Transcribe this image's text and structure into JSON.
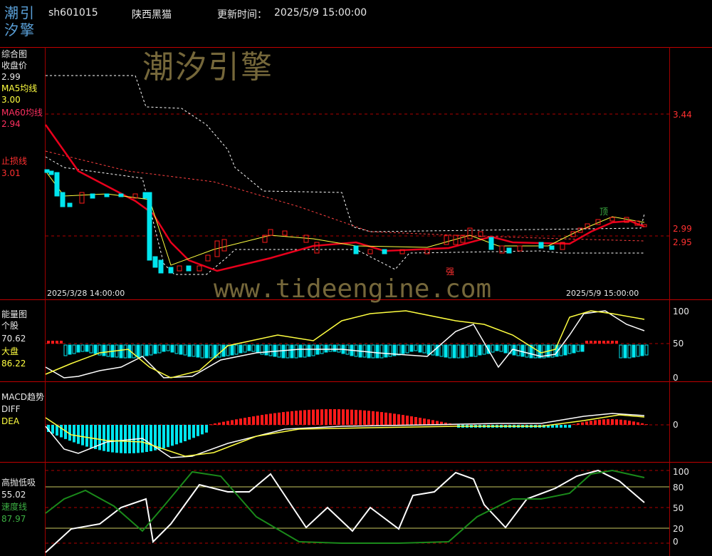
{
  "header": {
    "logo_line1": "潮引",
    "logo_line2": "汐擎",
    "code": "sh601015",
    "name": "陕西黑猫",
    "update_label": "更新时间：",
    "update_time": "2025/5/9 15:00:00"
  },
  "watermarks": {
    "brand": "潮汐引擎",
    "url": "www.tideengine.com"
  },
  "main_panel": {
    "title": "综合图",
    "close_label": "收盘价",
    "close_value": "2.99",
    "ma5_label": "MA5均线",
    "ma5_value": "3.00",
    "ma60_label": "MA60均线",
    "ma60_value": "2.94",
    "stop_label": "止损线",
    "stop_value": "3.01",
    "price_ticks": [
      "3.44",
      "2.99",
      "2.95"
    ],
    "top_marker": "顶",
    "strong_marker": "强",
    "start_date": "2025/3/28 14:00:00",
    "end_date": "2025/5/9 15:00:00"
  },
  "energy_panel": {
    "title": "能量图",
    "stock_label": "个股",
    "stock_value": "70.62",
    "market_label": "大盘",
    "market_value": "86.22",
    "ticks": [
      "100",
      "50",
      "0"
    ]
  },
  "macd_panel": {
    "title": "MACD趋势",
    "diff_label": "DIFF",
    "dea_label": "DEA",
    "ticks": [
      "0"
    ]
  },
  "tide_panel": {
    "title": "高抛低吸",
    "value": "55.02",
    "speed_label": "速度线",
    "speed_value": "87.97",
    "ticks": [
      "100",
      "80",
      "50",
      "20",
      "0"
    ]
  },
  "colors": {
    "up": "#ff1a1a",
    "down": "#00e5ee",
    "ma60": "#e8001c",
    "yellow": "#ffff40",
    "white": "#ffffff",
    "green": "#1a8a1a"
  }
}
